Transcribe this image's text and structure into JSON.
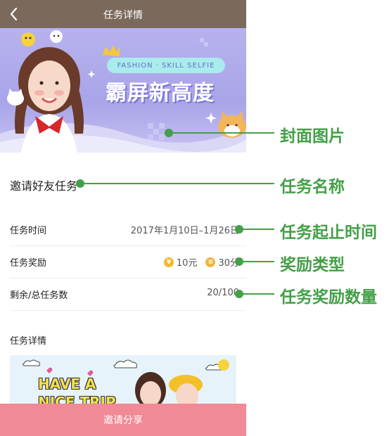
{
  "navbar": {
    "title": "任务详情",
    "back_icon": "chevron-left-icon"
  },
  "banner": {
    "tag": "FASHION · SKILL SELFIE",
    "headline": "霸屏新高度"
  },
  "task": {
    "name": "邀请好友任务"
  },
  "rows": {
    "time": {
      "label": "任务时间",
      "value": "2017年1月10日–1月26日"
    },
    "reward": {
      "label": "任务奖励",
      "coin_value": "10元",
      "score_value": "30分",
      "coin_glyph": "¥",
      "score_glyph": "≡"
    },
    "count": {
      "label": "剩余/总任务数",
      "value": "20/100"
    }
  },
  "details": {
    "title": "任务详情",
    "image_text": "HAVE A NICE TRIP"
  },
  "share_button": {
    "label": "邀请分享"
  },
  "annotations": {
    "cover": "封面图片",
    "name": "任务名称",
    "time": "任务起止时间",
    "reward_type": "奖励类型",
    "reward_count": "任务奖励数量"
  },
  "colors": {
    "navbar": "#7b6a5c",
    "accent_button": "#f08a96",
    "annotation": "#43a047",
    "banner_bg": "#b7b2ee"
  }
}
